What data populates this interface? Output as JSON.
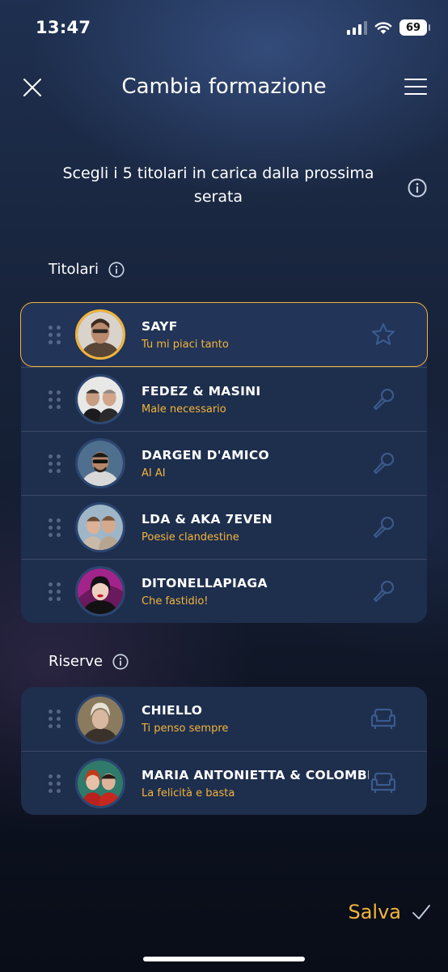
{
  "status_bar": {
    "time": "13:47",
    "battery": "69"
  },
  "header": {
    "title": "Cambia formazione"
  },
  "instruction": "Scegli i 5 titolari in carica dalla prossima serata",
  "sections": {
    "titolari_label": "Titolari",
    "riserve_label": "Riserve"
  },
  "titolari": [
    {
      "artist": "SAYF",
      "song": "Tu mi piaci tanto",
      "icon": "star-icon"
    },
    {
      "artist": "FEDEZ & MASINI",
      "song": "Male necessario",
      "icon": "microphone-icon"
    },
    {
      "artist": "DARGEN D'AMICO",
      "song": "AI AI",
      "icon": "microphone-icon"
    },
    {
      "artist": "LDA & AKA 7EVEN",
      "song": "Poesie clandestine",
      "icon": "microphone-icon"
    },
    {
      "artist": "DITONELLAPIAGA",
      "song": "Che fastidio!",
      "icon": "microphone-icon"
    }
  ],
  "riserve": [
    {
      "artist": "CHIELLO",
      "song": "Ti penso sempre",
      "icon": "armchair-icon"
    },
    {
      "artist": "MARIA ANTONIETTA & COLOMBRE",
      "song": "La felicità e basta",
      "icon": "armchair-icon"
    }
  ],
  "actions": {
    "save_label": "Salva"
  },
  "colors": {
    "accent": "#f3b53b",
    "card": "#1e2e4d",
    "icon_muted": "#3a5a8c"
  }
}
